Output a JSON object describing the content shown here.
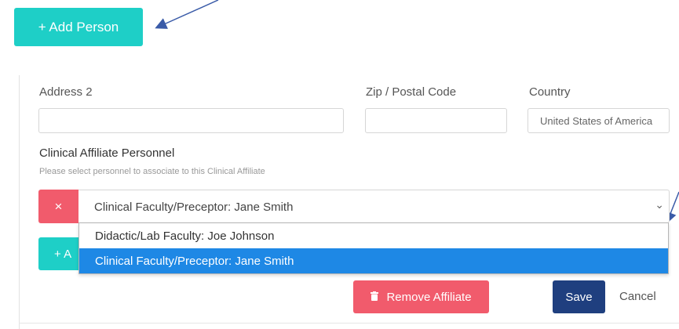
{
  "top": {
    "add_person_label": "+ Add Person"
  },
  "form": {
    "address2_label": "Address 2",
    "address2_value": "",
    "zip_label": "Zip / Postal Code",
    "zip_value": "",
    "country_label": "Country",
    "country_value": "United States of America"
  },
  "personnel": {
    "heading": "Clinical Affiliate Personnel",
    "hint": "Please select personnel to associate to this Clinical Affiliate",
    "remove_icon": "×",
    "selected_value": "Clinical Faculty/Preceptor: Jane Smith",
    "chevron_icon": "⌄",
    "add_button_partial": "+ A",
    "options": [
      {
        "label": "Didactic/Lab Faculty: Joe Johnson",
        "highlighted": false
      },
      {
        "label": "Clinical Faculty/Preceptor: Jane Smith",
        "highlighted": true
      }
    ]
  },
  "actions": {
    "remove_affiliate_label": "Remove Affiliate",
    "save_label": "Save",
    "cancel_label": "Cancel"
  },
  "colors": {
    "accent_teal": "#1ecfc7",
    "danger": "#f15b6c",
    "navy": "#1f3f7f",
    "highlight": "#1e88e5",
    "arrow": "#3a5ba8"
  }
}
